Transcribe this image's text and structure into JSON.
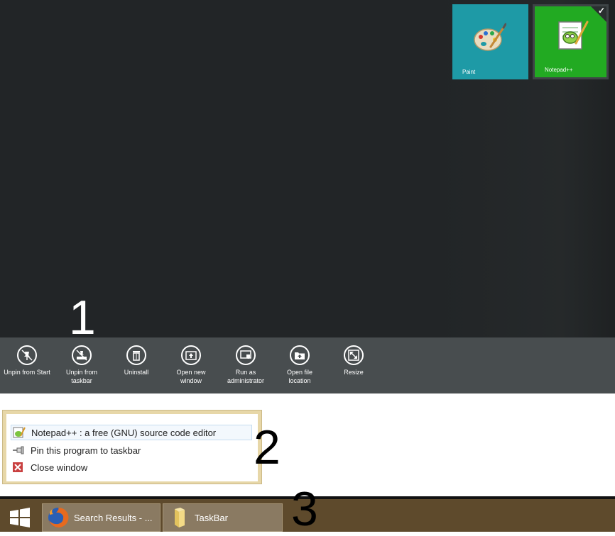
{
  "annotations": {
    "one": "1",
    "two": "2",
    "three": "3"
  },
  "tiles": [
    {
      "name": "Paint",
      "color": "#1e9aa6",
      "icon": "paint-palette-icon"
    },
    {
      "name": "Notepad++",
      "color": "#22aa22",
      "icon": "notepadpp-chameleon-icon",
      "selected": true
    }
  ],
  "app_bar": {
    "commands": [
      {
        "label": "Unpin from Start",
        "icon": "unpin-start-icon"
      },
      {
        "label": "Unpin from taskbar",
        "icon": "unpin-taskbar-icon"
      },
      {
        "label": "Uninstall",
        "icon": "trash-icon"
      },
      {
        "label": "Open new window",
        "icon": "new-window-icon"
      },
      {
        "label": "Run as administrator",
        "icon": "admin-shield-icon"
      },
      {
        "label": "Open file location",
        "icon": "folder-open-icon"
      },
      {
        "label": "Resize",
        "icon": "resize-icon"
      }
    ]
  },
  "jump_list": {
    "items": [
      {
        "label": "Notepad++ : a free (GNU) source code editor",
        "icon": "notepadpp-icon"
      },
      {
        "label": "Pin this program to taskbar",
        "icon": "pin-icon"
      },
      {
        "label": "Close window",
        "icon": "close-icon"
      }
    ]
  },
  "taskbar": {
    "buttons": [
      {
        "label": "Search Results - ...",
        "icon": "firefox-icon"
      },
      {
        "label": "TaskBar",
        "icon": "folder-icon"
      }
    ]
  }
}
